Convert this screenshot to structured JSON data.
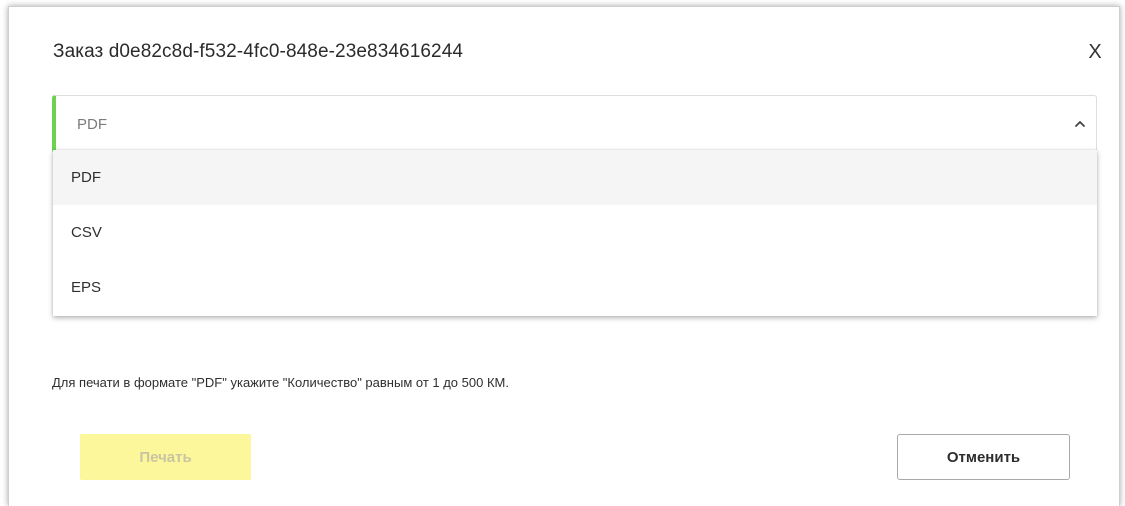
{
  "modal": {
    "title": "Заказ d0e82c8d-f532-4fc0-848e-23e834616244",
    "close_label": "X"
  },
  "format_select": {
    "value": "PDF",
    "chevron_icon": "chevron-up-icon",
    "accent_color": "#6dd24f",
    "options": [
      "PDF",
      "CSV",
      "EPS"
    ],
    "selected_index": 0
  },
  "hint": "Для печати в формате \"PDF\" укажите \"Количество\" равным от 1 до 500 КМ.",
  "buttons": {
    "print_label": "Печать",
    "print_color": "#fbf79a",
    "cancel_label": "Отменить"
  }
}
